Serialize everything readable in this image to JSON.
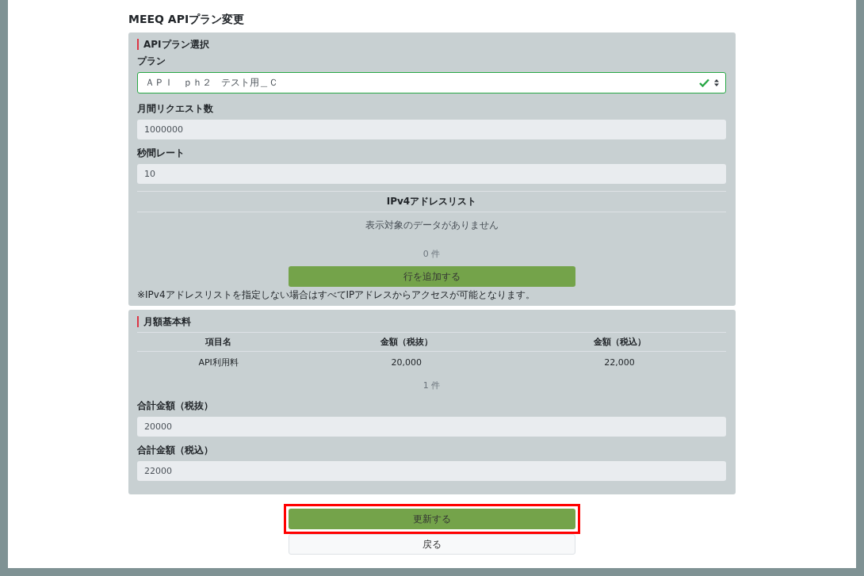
{
  "page_title": "MEEQ APIプラン変更",
  "plan_section": {
    "title": "APIプラン選択",
    "plan_field": {
      "label": "プラン",
      "value": "ＡＰＩ　ｐｈ２　テスト用＿Ｃ",
      "valid": true
    },
    "fields": [
      {
        "label": "月間リクエスト数",
        "value": "1000000"
      },
      {
        "label": "秒間レート",
        "value": "10"
      }
    ],
    "ip_table": {
      "heading": "IPv4アドレスリスト",
      "empty_message": "表示対象のデータがありません",
      "count": "0 件"
    },
    "add_row_button": "行を追加する",
    "note": "※IPv4アドレスリストを指定しない場合はすべてIPアドレスからアクセスが可能となります。"
  },
  "fee_section": {
    "title": "月額基本料",
    "table": {
      "columns": [
        "項目名",
        "金額（税抜）",
        "金額（税込）"
      ],
      "rows": [
        [
          "API利用料",
          "20,000",
          "22,000"
        ]
      ],
      "count": "1 件"
    },
    "fields": [
      {
        "label": "合計金額（税抜）",
        "value": "20000"
      },
      {
        "label": "合計金額（税込）",
        "value": "22000"
      }
    ]
  },
  "buttons": [
    {
      "label": "更新する",
      "kind": "primary",
      "highlighted": true
    },
    {
      "label": "戻る",
      "kind": "secondary",
      "highlighted": false
    }
  ]
}
